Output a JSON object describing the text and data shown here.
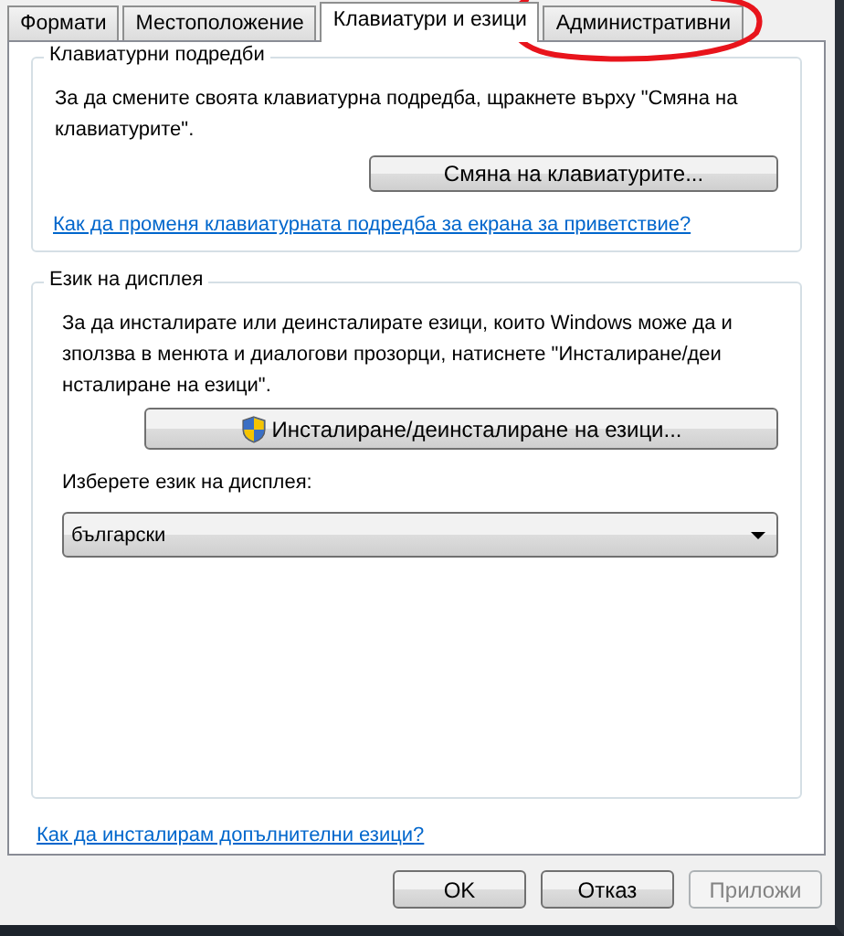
{
  "tabs": [
    {
      "label": "Формати",
      "selected": false
    },
    {
      "label": "Местоположение",
      "selected": false
    },
    {
      "label": "Клавиатури и езици",
      "selected": true
    },
    {
      "label": "Административни",
      "selected": false
    }
  ],
  "keyboards_group": {
    "title": "Клавиатурни подредби",
    "text": "За да смените своята клавиатурна подредба, щракнете върху \"Смяна на\nклавиатурите\".",
    "button": "Смяна на клавиатурите...",
    "link": "Как да променя клавиатурната подредба за екрана за приветствие?"
  },
  "display_language_group": {
    "title": "Език на дисплея",
    "text": "За да инсталирате или деинсталирате езици, които Windows може да и\nзползва в менюта и диалогови прозорци, натиснете \"Инсталиране/деи\nнсталиране на езици\".",
    "button": "Инсталиране/деинсталиране на езици...",
    "select_label": "Изберете език на дисплея:",
    "select_value": "български"
  },
  "bottom_link": "Как да инсталирам допълнителни езици?",
  "buttons": [
    {
      "label": "OK",
      "disabled": false
    },
    {
      "label": "Отказ",
      "disabled": false
    },
    {
      "label": "Приложи",
      "disabled": true
    }
  ]
}
